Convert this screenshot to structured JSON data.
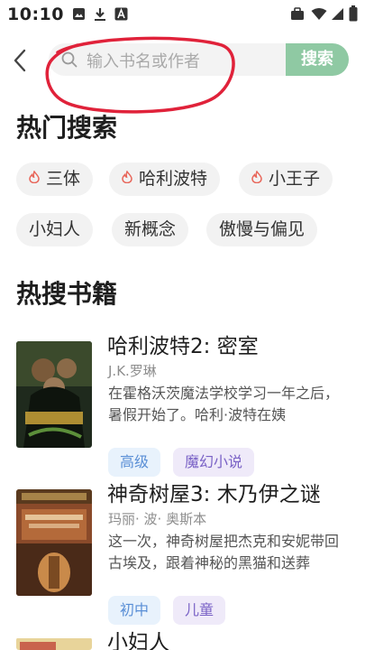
{
  "status_bar": {
    "time": "10:10",
    "left_icons": [
      "image-icon",
      "download-icon",
      "a-icon"
    ],
    "right_icons": [
      "briefcase-icon",
      "wifi-icon",
      "signal-icon",
      "battery-icon"
    ]
  },
  "header": {
    "back_icon": "chevron-left-icon",
    "search": {
      "placeholder": "输入书名或作者",
      "button_label": "搜索"
    }
  },
  "hot_search": {
    "title": "热门搜索",
    "chips": [
      {
        "label": "三体",
        "hot": true
      },
      {
        "label": "哈利波特",
        "hot": true
      },
      {
        "label": "小王子",
        "hot": true
      },
      {
        "label": "小妇人",
        "hot": false
      },
      {
        "label": "新概念",
        "hot": false
      },
      {
        "label": "傲慢与偏见",
        "hot": false
      }
    ]
  },
  "hot_books": {
    "title": "热搜书籍",
    "books": [
      {
        "title": "哈利波特2: 密室",
        "author": "J.K.罗琳",
        "description": "在霍格沃茨魔法学校学习一年之后，暑假开始了。哈利·波特在姨",
        "tags": [
          "高级",
          "魔幻小说"
        ]
      },
      {
        "title": "神奇树屋3: 木乃伊之谜",
        "author": "玛丽· 波· 奥斯本",
        "description": "这一次，神奇树屋把杰克和安妮带回古埃及，跟着神秘的黑猫和送葬",
        "tags": [
          "初中",
          "儿童"
        ]
      },
      {
        "title": "小妇人",
        "author": "",
        "description": "",
        "tags": []
      }
    ]
  },
  "colors": {
    "search_button": "#8fc9a3",
    "flame": "#e8665a",
    "tag_blue_text": "#5a8fd6",
    "tag_purple_text": "#7a62c6",
    "annotation": "#e0223a"
  }
}
